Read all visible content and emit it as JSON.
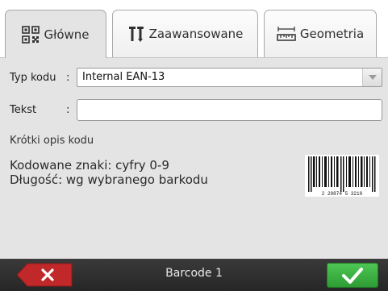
{
  "tabs": [
    {
      "label": "Główne",
      "icon": "qr-code-icon",
      "active": true
    },
    {
      "label": "Zaawansowane",
      "icon": "tools-icon",
      "active": false
    },
    {
      "label": "Geometria",
      "icon": "ruler-icon",
      "active": false
    }
  ],
  "form": {
    "type_label": "Typ kodu",
    "type_colon": ":",
    "type_value": "Internal EAN-13",
    "text_label": "Tekst",
    "text_colon": ":",
    "text_value": ""
  },
  "description": {
    "title": "Krótki opis kodu",
    "line1": "Kodowane znaki: cyfry 0-9",
    "line2": "Długość: wg wybranego barkodu"
  },
  "barcode_preview": {
    "digits": "2  20874  5 3210"
  },
  "bottom": {
    "title": "Barcode 1"
  },
  "colors": {
    "panel_bg": "#e4e4e4",
    "cancel_red": "#c0282a",
    "ok_green": "#3bb342",
    "bottom_bar": "#2e2e2e"
  }
}
